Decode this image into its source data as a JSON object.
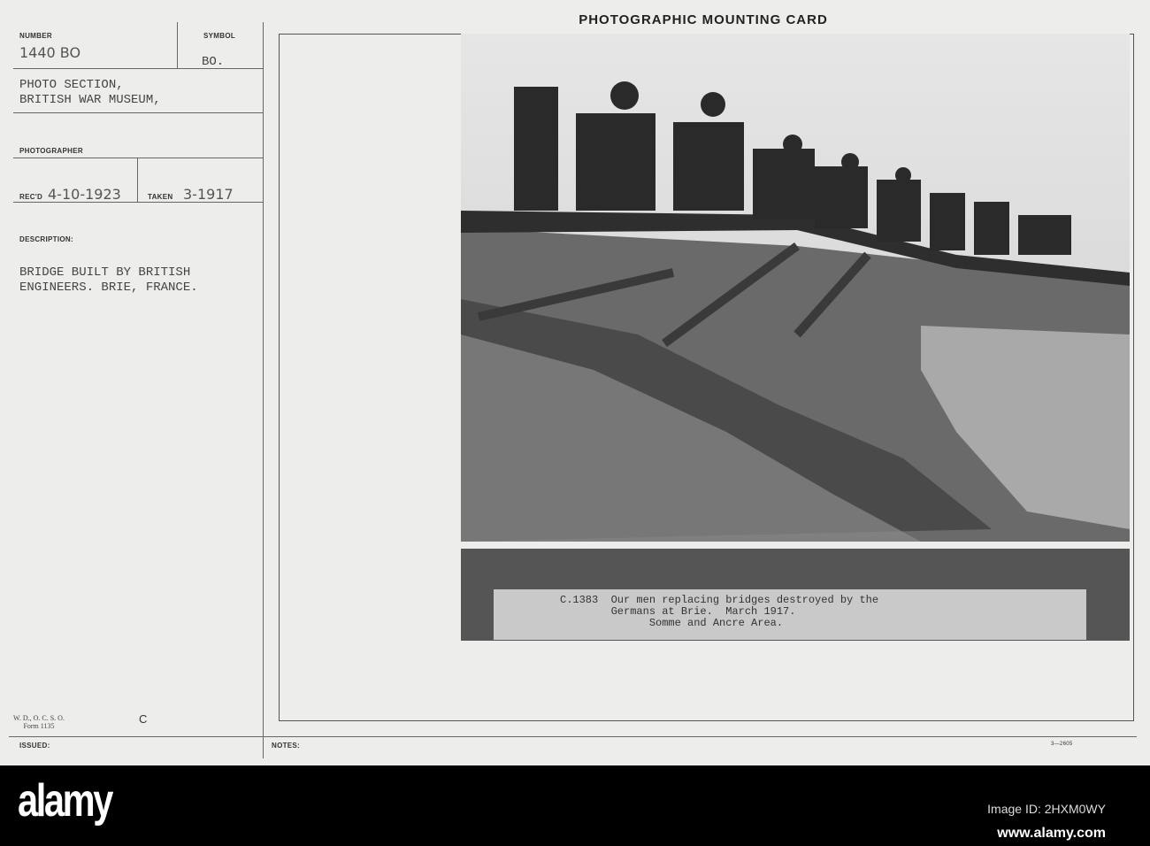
{
  "card": {
    "title": "Photographic Mounting Card",
    "number_label": "NUMBER",
    "number_value": "1440 BO",
    "symbol_label": "SYMBOL",
    "symbol_value": "BO.",
    "source_line1": "PHOTO SECTION,",
    "source_line2": "BRITISH WAR MUSEUM,",
    "photographer_label": "PHOTOGRAPHER",
    "recd_label": "REC'D",
    "recd_value": "4-10-1923",
    "taken_label": "TAKEN",
    "taken_value": "3-1917",
    "description_label": "DESCRIPTION:",
    "description_line1": "BRIDGE BUILT BY BRITISH",
    "description_line2": "ENGINEERS. BRIE, FRANCE.",
    "form_line1": "W. D., O. C. S. O.",
    "form_line2": "Form 1135",
    "form_letter": "C",
    "issued_label": "ISSUED:",
    "notes_label": "NOTES:",
    "print_code": "3—2605"
  },
  "photo": {
    "caption": "C.1383  Our men replacing bridges destroyed by the\n        Germans at Brie.  March 1917.\n              Somme and Ancre Area."
  },
  "footer": {
    "logo": "alamy",
    "image_id": "Image ID: 2HXM0WY",
    "url": "www.alamy.com"
  }
}
